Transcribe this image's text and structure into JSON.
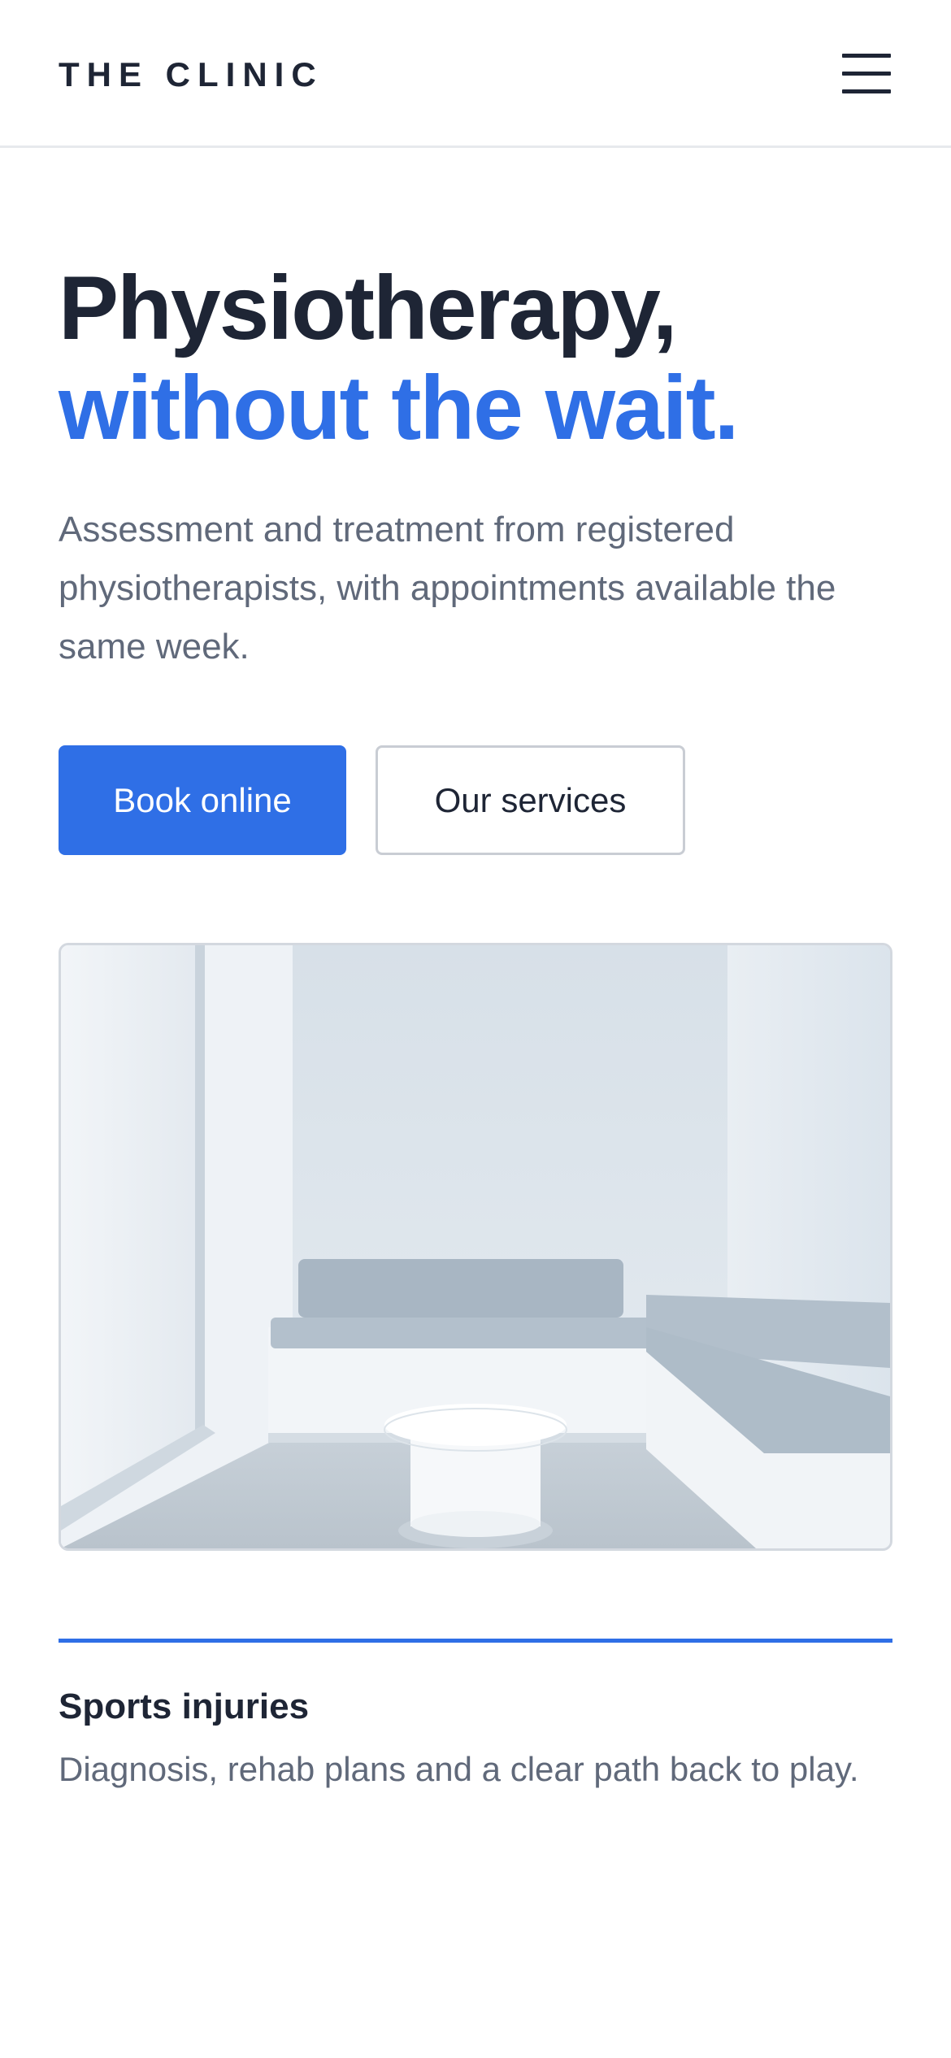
{
  "header": {
    "brand": "THE CLINIC",
    "menu_icon": "hamburger-menu-icon"
  },
  "hero": {
    "headline_line1": "Physiotherapy,",
    "headline_line2": "without the wait.",
    "description": "Assessment and treatment from registered physiotherapists, with appointments available the same week.",
    "primary_button": "Book online",
    "secondary_button": "Our services",
    "image_alt": "Bright, minimal waiting room with upholstered benches and a round white table"
  },
  "feature": {
    "title": "Sports injuries",
    "description": "Diagnosis, rehab plans and a clear path back to play."
  },
  "colors": {
    "accent": "#2f6fe6",
    "text_dark": "#1e2535",
    "text_muted": "#60697a",
    "border": "#c9cdd4"
  }
}
